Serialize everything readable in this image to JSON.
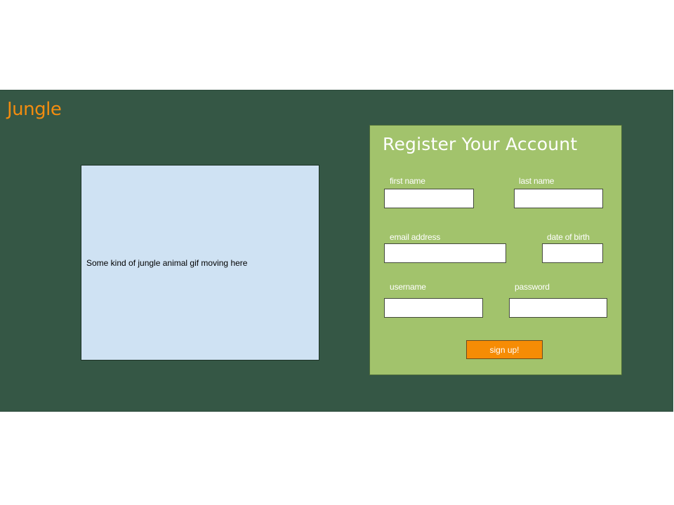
{
  "header": {
    "brand": "Jungle"
  },
  "media": {
    "placeholder_text": "Some kind of jungle animal gif moving here"
  },
  "register_form": {
    "title": "Register Your Account",
    "fields": {
      "first_name": {
        "label": "first name",
        "value": ""
      },
      "last_name": {
        "label": "last name",
        "value": ""
      },
      "email": {
        "label": "email address",
        "value": ""
      },
      "dob": {
        "label": "date of birth",
        "value": ""
      },
      "username": {
        "label": "username",
        "value": ""
      },
      "password": {
        "label": "password",
        "value": ""
      }
    },
    "submit_label": "sign up!"
  },
  "colors": {
    "page_background": "#ffffff",
    "banner_background": "#355745",
    "brand_text": "#f28c0f",
    "placeholder_box": "#cfe2f3",
    "form_panel": "#a2c36c",
    "form_text": "#ffffff",
    "button_background": "#f68c05"
  }
}
